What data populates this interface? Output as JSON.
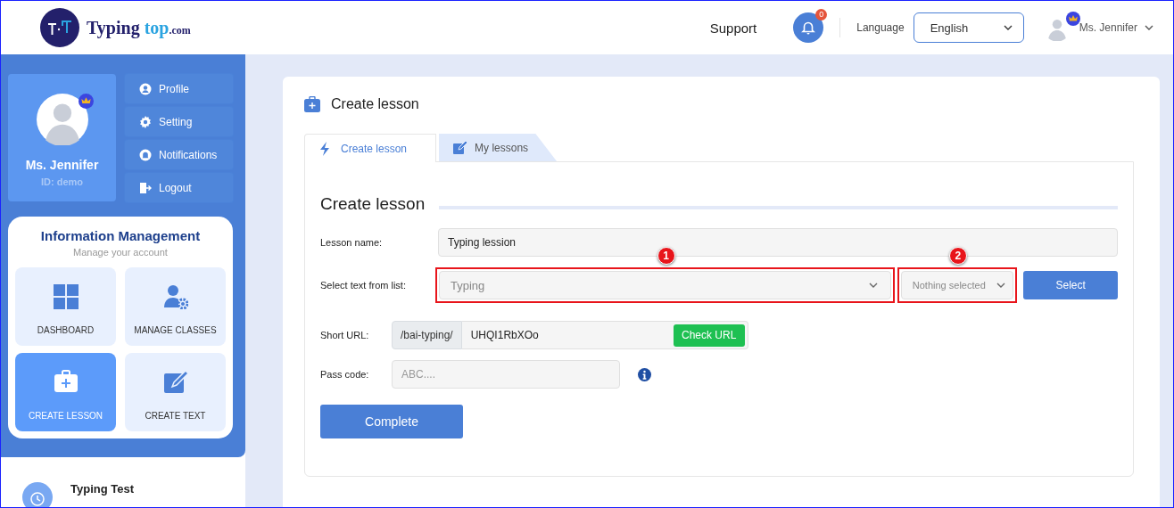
{
  "header": {
    "logo": {
      "word_1": "Typing",
      "word_2": "top",
      "suffix": ".com"
    },
    "support": "Support",
    "notifications": {
      "count": "0"
    },
    "language": {
      "label": "Language",
      "value": "English"
    },
    "user": {
      "name": "Ms. Jennifer"
    }
  },
  "sidebar": {
    "profile": {
      "name": "Ms. Jennifer",
      "id": "ID: demo"
    },
    "menu": [
      {
        "label": "Profile",
        "kind": "profile"
      },
      {
        "label": "Setting",
        "kind": "setting"
      },
      {
        "label": "Notifications",
        "kind": "notifications"
      },
      {
        "label": "Logout",
        "kind": "logout"
      }
    ],
    "info": {
      "title": "Information Management",
      "subtitle": "Manage your account",
      "tiles": [
        {
          "label": "DASHBOARD",
          "kind": "dashboard",
          "selected": false
        },
        {
          "label": "MANAGE CLASSES",
          "kind": "classes",
          "selected": false
        },
        {
          "label": "CREATE LESSON",
          "kind": "lesson",
          "selected": true
        },
        {
          "label": "CREATE TEXT",
          "kind": "text",
          "selected": false
        }
      ]
    },
    "extra": {
      "title": "Typing Test"
    }
  },
  "main": {
    "title": "Create lesson",
    "tabs": [
      {
        "label": "Create lesson",
        "kind": "bolt",
        "selected": true
      },
      {
        "label": "My lessons",
        "kind": "edit",
        "selected": false
      }
    ],
    "form": {
      "heading": "Create lesson",
      "lesson_name": {
        "label": "Lesson name:",
        "value": "Typing lession"
      },
      "text_list": {
        "label": "Select text from list:",
        "placeholder": "Typing",
        "callout": "1"
      },
      "filter": {
        "placeholder": "Nothing selected",
        "callout": "2"
      },
      "select_button": "Select",
      "short_url": {
        "label": "Short URL:",
        "prefix": "/bai-typing/",
        "value": "UHQI1RbXOo",
        "button": "Check URL"
      },
      "pass_code": {
        "label": "Pass code:",
        "placeholder": "ABC...."
      },
      "complete": "Complete"
    }
  }
}
